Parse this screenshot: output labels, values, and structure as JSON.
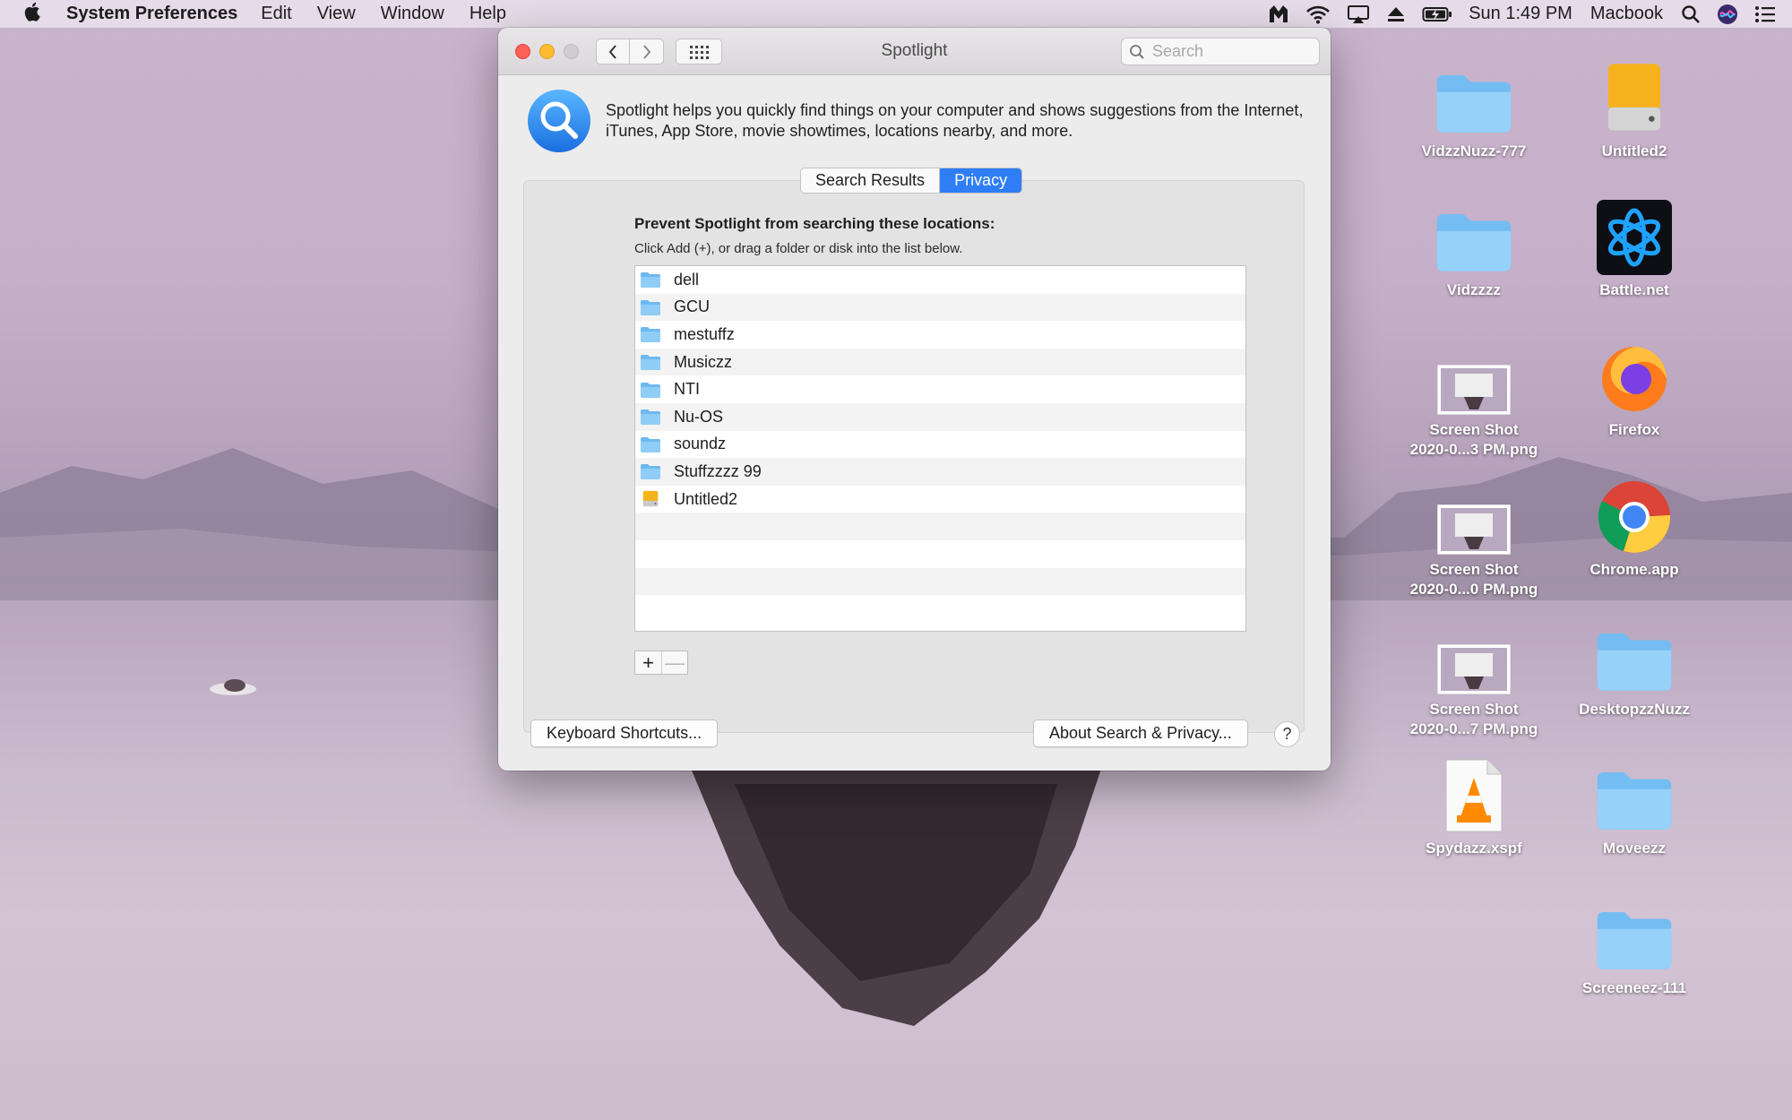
{
  "menubar": {
    "app_name": "System Preferences",
    "menus": [
      "Edit",
      "View",
      "Window",
      "Help"
    ],
    "clock": "Sun 1:49 PM",
    "user": "Macbook"
  },
  "window": {
    "title": "Spotlight",
    "search_placeholder": "Search",
    "description": "Spotlight helps you quickly find things on your computer and shows suggestions from the Internet, iTunes, App Store, movie showtimes, locations nearby, and more.",
    "tabs": [
      {
        "label": "Search Results",
        "active": false
      },
      {
        "label": "Privacy",
        "active": true
      }
    ],
    "privacy": {
      "heading": "Prevent Spotlight from searching these locations:",
      "subheading": "Click Add (+), or drag a folder or disk into the list below.",
      "locations": [
        {
          "name": "dell",
          "icon": "folder-icon"
        },
        {
          "name": "GCU",
          "icon": "folder-icon"
        },
        {
          "name": "mestuffz",
          "icon": "folder-icon"
        },
        {
          "name": "Musiczz",
          "icon": "folder-icon"
        },
        {
          "name": "NTI",
          "icon": "folder-icon"
        },
        {
          "name": "Nu-OS",
          "icon": "folder-icon"
        },
        {
          "name": "soundz",
          "icon": "folder-icon"
        },
        {
          "name": "Stuffzzzz 99",
          "icon": "folder-icon"
        },
        {
          "name": "Untitled2",
          "icon": "disk-icon"
        }
      ],
      "add_label": "+",
      "remove_label": "—"
    },
    "keyboard_shortcuts_label": "Keyboard Shortcuts...",
    "about_label": "About Search & Privacy...",
    "help_label": "?"
  },
  "desktop": {
    "icons": [
      {
        "label": "VidzzNuzz-777",
        "icon": "folder-icon"
      },
      {
        "label": "Untitled2",
        "icon": "disk-icon"
      },
      {
        "label": "Vidzzzz",
        "icon": "folder-icon"
      },
      {
        "label": "Battle.net",
        "icon": "battlenet-icon"
      },
      {
        "label": "Screen Shot\n2020-0...3 PM.png",
        "icon": "screenshot-icon"
      },
      {
        "label": "Firefox",
        "icon": "firefox-icon"
      },
      {
        "label": "Screen Shot\n2020-0...0 PM.png",
        "icon": "screenshot-icon"
      },
      {
        "label": "Chrome.app",
        "icon": "chrome-icon"
      },
      {
        "label": "Screen Shot\n2020-0...7 PM.png",
        "icon": "screenshot-icon"
      },
      {
        "label": "DesktopzzNuzz",
        "icon": "folder-icon"
      },
      {
        "label": "Spydazz.xspf",
        "icon": "vlc-file-icon"
      },
      {
        "label": "Moveezz",
        "icon": "folder-icon"
      },
      {
        "label": "Screeneez-111",
        "icon": "folder-icon"
      }
    ]
  },
  "colors": {
    "accent": "#2f7ef5",
    "folder": "#7cc3f2"
  }
}
